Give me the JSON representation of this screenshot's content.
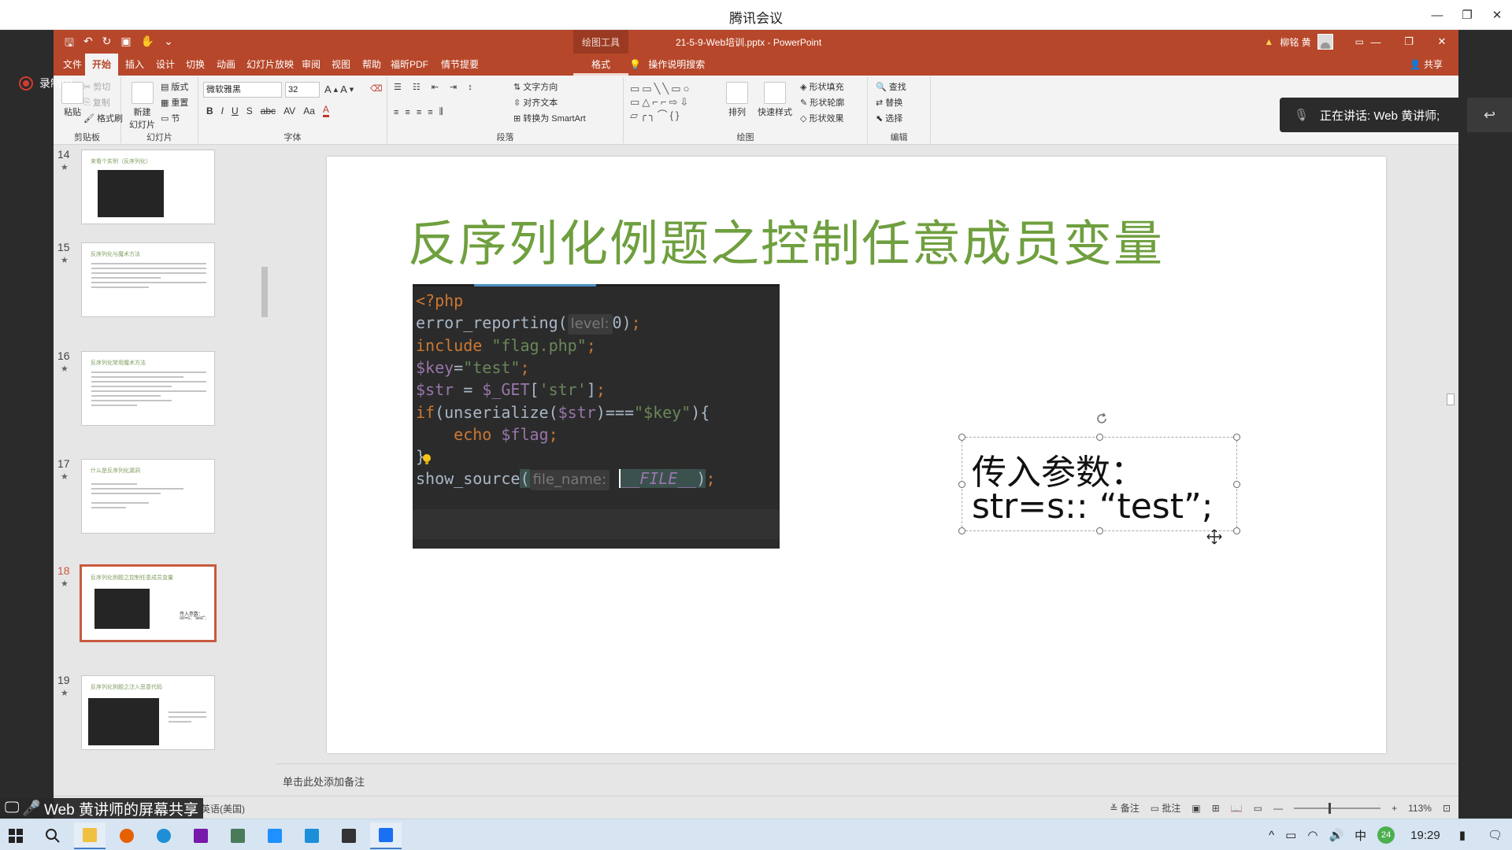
{
  "meeting": {
    "title": "腾讯会议",
    "recording_label": "录制中",
    "speaking_label": "正在讲话: Web 黄讲师;",
    "screen_share_label": "Web 黄讲师的屏幕共享"
  },
  "powerpoint": {
    "contextual_tools": "绘图工具",
    "document_title": "21-5-9-Web培训.pptx  -  PowerPoint",
    "user_name": "柳铭 黄",
    "tabs": [
      {
        "label": "文件"
      },
      {
        "label": "开始"
      },
      {
        "label": "插入"
      },
      {
        "label": "设计"
      },
      {
        "label": "切换"
      },
      {
        "label": "动画"
      },
      {
        "label": "幻灯片放映"
      },
      {
        "label": "审阅"
      },
      {
        "label": "视图"
      },
      {
        "label": "帮助"
      },
      {
        "label": "福昕PDF"
      },
      {
        "label": "情节提要"
      },
      {
        "label": "格式"
      }
    ],
    "tell_me": "操作说明搜索",
    "share": "共享",
    "active_tab": "开始",
    "ribbon": {
      "clipboard": {
        "label": "剪贴板",
        "paste": "粘贴",
        "cut": "剪切",
        "copy": "复制",
        "format_painter": "格式刷"
      },
      "slides": {
        "label": "幻灯片",
        "new_slide": "新建\n幻灯片",
        "layout": "版式",
        "reset": "重置",
        "section": "节"
      },
      "font": {
        "label": "字体",
        "font_name": "微软雅黑",
        "font_size": "32"
      },
      "paragraph": {
        "label": "段落",
        "text_direction": "文字方向",
        "align_text": "对齐文本",
        "convert_smartart": "转换为 SmartArt"
      },
      "drawing": {
        "label": "绘图",
        "arrange": "排列",
        "quick_styles": "快速样式",
        "shape_fill": "形状填充",
        "shape_outline": "形状轮廓",
        "shape_effects": "形状效果"
      },
      "editing": {
        "label": "编辑",
        "find": "查找",
        "replace": "替换",
        "select": "选择"
      }
    },
    "thumbnails": [
      {
        "number": "14",
        "title": "来看个实例（反序列化）"
      },
      {
        "number": "15",
        "title": "反序列化与魔术方法"
      },
      {
        "number": "16",
        "title": "反序列化常用魔术方法"
      },
      {
        "number": "17",
        "title": "什么是反序列化漏洞"
      },
      {
        "number": "18",
        "title": "反序列化例题之控制任意成员变量",
        "selected": true,
        "small_text1": "传入参数：",
        "small_text2": "str=s:: \"test\";"
      },
      {
        "number": "19",
        "title": "反序列化例题之注入恶意代码"
      }
    ],
    "star": "★",
    "slide": {
      "title": "反序列化例题之控制任意成员变量",
      "code": {
        "line1": "<?php",
        "line2_fn": "error_reporting",
        "line2_hint": "level:",
        "line2_arg": "0",
        "line3_kw": "include",
        "line3_str": "\"flag.php\"",
        "line4_var": "$key",
        "line4_str": "\"test\"",
        "line5_var": "$str",
        "line5_get": "$_GET",
        "line5_key": "'str'",
        "line6_kw": "if",
        "line6_fn": "unserialize",
        "line6_var": "$str",
        "line6_op": "===",
        "line6_str": "\"$key\"",
        "line7_kw": "echo",
        "line7_var": "$flag",
        "line8": "}",
        "line9_fn": "show_source",
        "line9_hint": "file_name:",
        "line9_const": "__FILE__"
      },
      "textbox": {
        "line1": "传入参数：",
        "line2": "str=s::  “test”;"
      }
    },
    "notes_placeholder": "单击此处添加备注",
    "status": {
      "language": "英语(美国)",
      "notes": "备注",
      "comments": "批注",
      "zoom": "113%"
    }
  },
  "taskbar": {
    "ime": "中",
    "badge": "24",
    "time": "19:29"
  },
  "colors": {
    "ppt_accent": "#b7472a",
    "slide_title": "#6f9f3f",
    "code_bg": "#2b2b2b",
    "taskbar_bg": "#d7e4f2"
  },
  "icons": [
    "save-icon",
    "undo-icon",
    "redo-icon",
    "start-icon",
    "search-icon",
    "file-explorer-icon",
    "firefox-icon",
    "edge-icon",
    "onenote-icon",
    "chat-icon"
  ]
}
